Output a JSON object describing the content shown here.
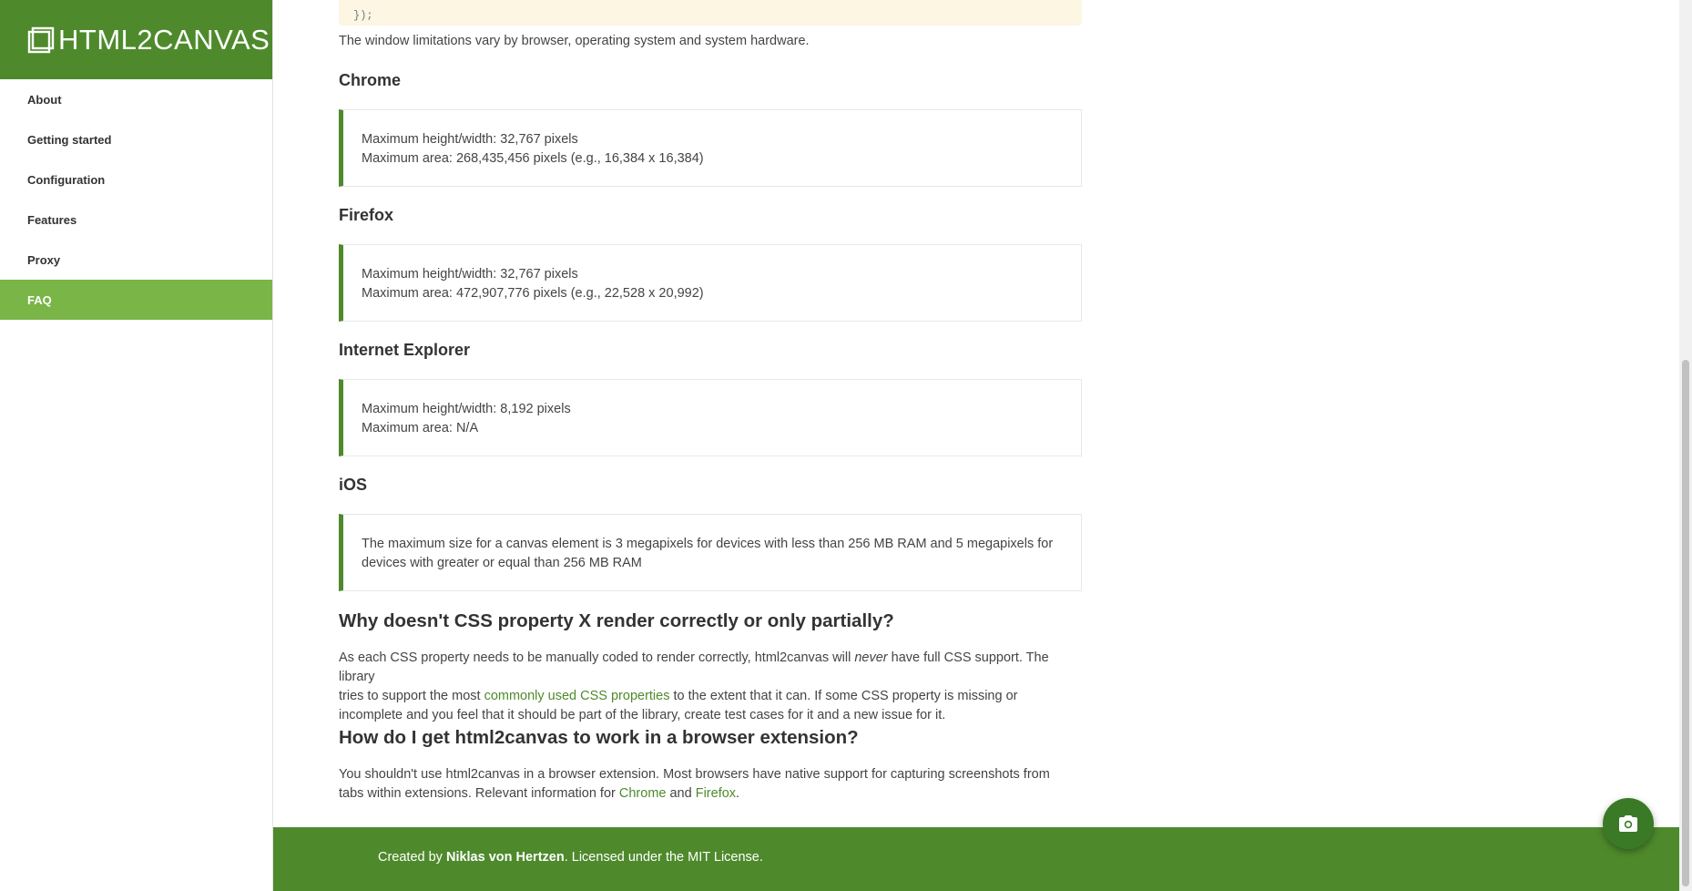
{
  "brand": {
    "title": "HTML2CANVAS"
  },
  "sidebar": {
    "items": [
      {
        "label": "About"
      },
      {
        "label": "Getting started"
      },
      {
        "label": "Configuration"
      },
      {
        "label": "Features"
      },
      {
        "label": "Proxy"
      },
      {
        "label": "FAQ",
        "active": true
      }
    ]
  },
  "content": {
    "code_tail": "});",
    "intro": "The window limitations vary by browser, operating system and system hardware.",
    "chrome": {
      "heading": "Chrome",
      "line1": "Maximum height/width: 32,767 pixels",
      "line2": "Maximum area: 268,435,456 pixels (e.g., 16,384 x 16,384)"
    },
    "firefox": {
      "heading": "Firefox",
      "line1": "Maximum height/width: 32,767 pixels",
      "line2": "Maximum area: 472,907,776 pixels (e.g., 22,528 x 20,992)"
    },
    "ie": {
      "heading": "Internet Explorer",
      "line1": "Maximum height/width: 8,192 pixels",
      "line2": "Maximum area: N/A"
    },
    "ios": {
      "heading": "iOS",
      "line1": "The maximum size for a canvas element is 3 megapixels for devices with less than 256 MB RAM and 5 megapixels for",
      "line2": "devices with greater or equal than 256 MB RAM"
    },
    "css_faq": {
      "heading": "Why doesn't CSS property X render correctly or only partially?",
      "p1_a": "As each CSS property needs to be manually coded to render correctly, html2canvas will ",
      "p1_em": "never",
      "p1_b": " have full CSS support. The library",
      "p2_a": "tries to support the most ",
      "p2_link": "commonly used CSS properties",
      "p2_b": " to the extent that it can. If some CSS property is missing or",
      "p3": "incomplete and you feel that it should be part of the library, create test cases for it and a new issue for it."
    },
    "ext_faq": {
      "heading": "How do I get html2canvas to work in a browser extension?",
      "p1": "You shouldn't use html2canvas in a browser extension. Most browsers have native support for capturing screenshots from",
      "p2_a": "tabs within extensions. Relevant information for ",
      "p2_link1": "Chrome",
      "p2_and": " and ",
      "p2_link2": "Firefox",
      "p2_end": "."
    }
  },
  "footer": {
    "prefix": "Created by ",
    "author": "Niklas von Hertzen",
    "suffix": ". Licensed under the MIT License."
  },
  "fab": {
    "icon": "camera-icon"
  },
  "colors": {
    "brand": "#4e8a2c",
    "active": "#7ab547",
    "link": "#4e8a2c"
  }
}
